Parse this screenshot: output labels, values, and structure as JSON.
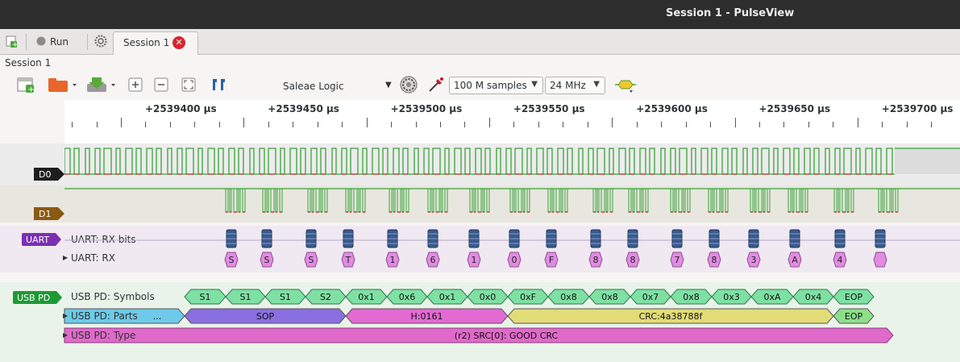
{
  "window": {
    "title": "Session 1 - PulseView"
  },
  "tabs": {
    "run_label": "Run",
    "session_tab_label": "Session 1",
    "close_glyph": "✕"
  },
  "session": {
    "label": "Session 1"
  },
  "toolbar": {
    "device": "Saleae Logic",
    "samples": "100 M samples",
    "samplerate": "24 MHz",
    "icons": [
      "new-view-icon",
      "open-file-icon",
      "save-icon",
      "zoom-in-icon",
      "zoom-out-icon",
      "zoom-fit-icon",
      "cursor-icon",
      "device-config-icon",
      "probe-icon",
      "add-decoder-icon"
    ]
  },
  "ruler": {
    "labels": [
      "+2539400 μs",
      "+2539450 μs",
      "+2539500 μs",
      "+2539550 μs",
      "+2539600 μs",
      "+2539650 μs",
      "+2539700 μs"
    ]
  },
  "channels": {
    "d0": {
      "label": "D0",
      "color": "#1e1e1e"
    },
    "d1": {
      "label": "D1",
      "color": "#8a5a12"
    }
  },
  "uart": {
    "badge": "UART",
    "badge_color": "#7b2fb2",
    "row_bits_label": "UART: RX bits",
    "row_rx_label": "UART: RX",
    "chars": [
      "S",
      "S",
      "S",
      "T",
      "1",
      "6",
      "1",
      "0",
      "F",
      "8",
      "8",
      "7",
      "8",
      "3",
      "A",
      "4",
      ""
    ]
  },
  "usbpd": {
    "badge": "USB PD",
    "badge_color": "#1e9a34",
    "symbols_label": "USB PD: Symbols",
    "parts_label": "USB PD: Parts",
    "type_label": "USB PD: Type",
    "symbols": [
      "S1",
      "S1",
      "S1",
      "S2",
      "0x1",
      "0x6",
      "0x1",
      "0x0",
      "0xF",
      "0x8",
      "0x8",
      "0x7",
      "0x8",
      "0x3",
      "0xA",
      "0x4",
      "EOP"
    ],
    "parts": [
      {
        "text": "...",
        "color": "#6ecae8"
      },
      {
        "text": "SOP",
        "color": "#8a6fe0"
      },
      {
        "text": "H:0161",
        "color": "#e36ad3"
      },
      {
        "text": "CRC:4a38788f",
        "color": "#e2dc78"
      },
      {
        "text": "EOP",
        "color": "#8de08a"
      }
    ],
    "type_text": "(r2) SRC[0]: GOOD CRC",
    "type_color": "#e06ac9"
  }
}
